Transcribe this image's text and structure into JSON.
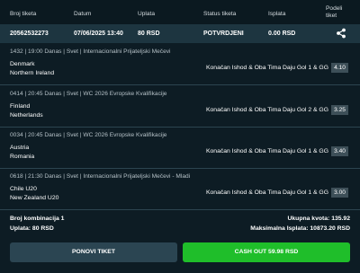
{
  "header": {
    "ticket_id": "Broj tiketa",
    "date": "Datum",
    "stake": "Uplata",
    "status": "Status tiketa",
    "payout": "Isplata",
    "share": "Podeli tiket"
  },
  "ticket": {
    "id": "20562532273",
    "date": "07/06/2025 13:40",
    "stake": "80 RSD",
    "status": "POTVRDJENI",
    "payout": "0.00 RSD",
    "share_icon": "share-icon"
  },
  "matches": [
    {
      "info": "1432 | 19:00 Danas | Svet | Internacionalni Prijateljski Mečevi",
      "home": "Denmark",
      "away": "Northern Ireland",
      "bet": "Konačan Ishod & Oba Tima Daju Gol 1 & GG",
      "odd": "4.10"
    },
    {
      "info": "0414 | 20:45 Danas | Svet | WC 2026 Evropske Kvalifikacije",
      "home": "Finland",
      "away": "Netherlands",
      "bet": "Konačan Ishod & Oba Tima Daju Gol 2 & GG",
      "odd": "3.25"
    },
    {
      "info": "0034 | 20:45 Danas | Svet | WC 2026 Evropske Kvalifikacije",
      "home": "Austria",
      "away": "Romania",
      "bet": "Konačan Ishod & Oba Tima Daju Gol 1 & GG",
      "odd": "3.40"
    },
    {
      "info": "0618 | 21:30 Danas | Svet | Internacionalni Prijateljski Mečevi - Mladi",
      "home": "Chile U20",
      "away": "New Zealand U20",
      "bet": "Konačan Ishod & Oba Tima Daju Gol 1 & GG",
      "odd": "3.00"
    }
  ],
  "footer": {
    "combinations": "Broj kombinacija 1",
    "stake": "Uplata: 80 RSD",
    "total_odds": "Ukupna kvota: 135.92",
    "max_payout": "Maksimalna Isplata: 10873.20 RSD"
  },
  "buttons": {
    "repeat": "PONOVI TIKET",
    "cashout": "CASH OUT 59.98 RSD"
  },
  "colors": {
    "background": "#0d1c24",
    "summary_row": "#1d3540",
    "cashout": "#1fbe2a",
    "repeat": "#2b4552"
  }
}
